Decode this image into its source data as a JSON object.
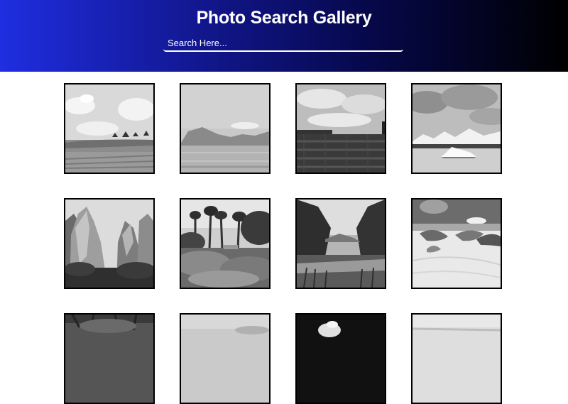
{
  "header": {
    "title": "Photo Search Gallery",
    "background_gradient": [
      "#1f2ee0",
      "#12178f",
      "#06084a",
      "#000000"
    ]
  },
  "search": {
    "placeholder": "Search Here...",
    "value": ""
  },
  "gallery": {
    "photos": [
      {
        "subject": "grassy field with clouds"
      },
      {
        "subject": "lake with mountains"
      },
      {
        "subject": "cloudy sky over grassland"
      },
      {
        "subject": "glacier lagoon with icebergs"
      },
      {
        "subject": "canyon rock formations"
      },
      {
        "subject": "garden with trees"
      },
      {
        "subject": "river through forest"
      },
      {
        "subject": "sand dunes with shrubs"
      },
      {
        "subject": "trees"
      },
      {
        "subject": "sky"
      },
      {
        "subject": "dark landscape"
      },
      {
        "subject": "pale landscape"
      }
    ]
  }
}
